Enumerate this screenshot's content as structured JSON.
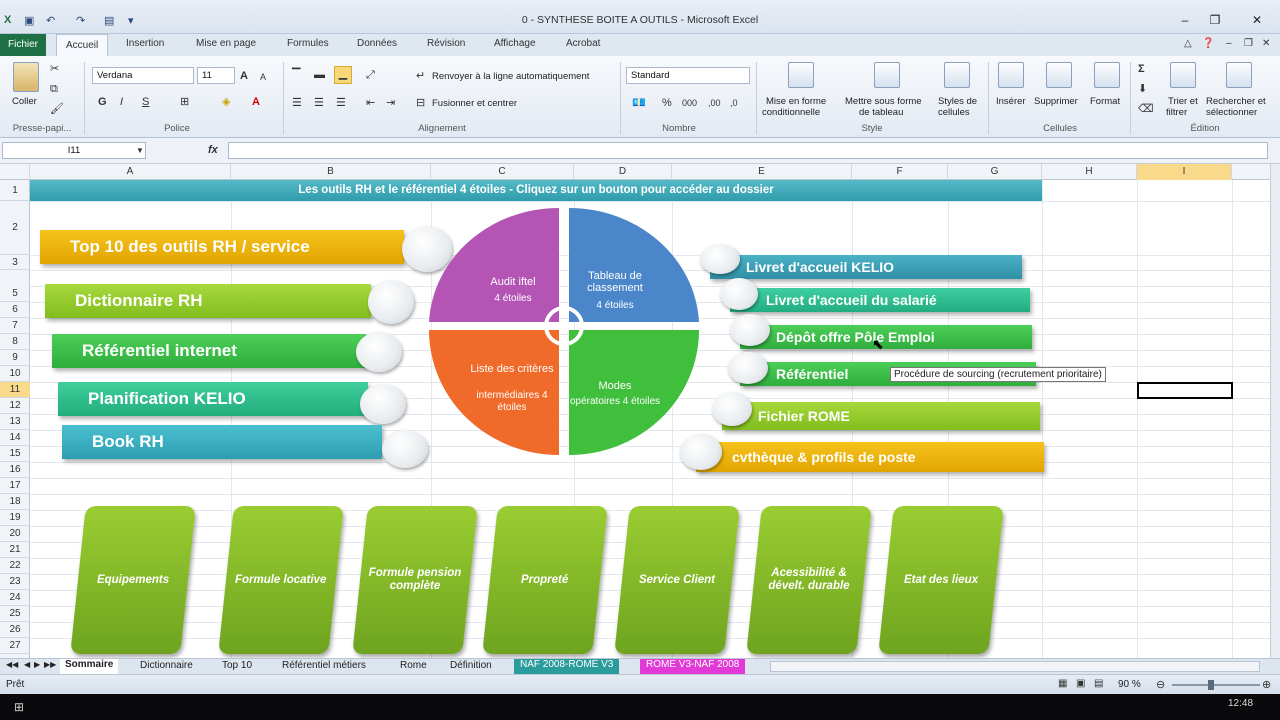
{
  "window": {
    "title": "0 - SYNTHESE BOITE A OUTILS - Microsoft Excel",
    "minimize": "–",
    "restore": "❐",
    "close": "✕"
  },
  "tabs": {
    "file": "Fichier",
    "items": [
      "Accueil",
      "Insertion",
      "Mise en page",
      "Formules",
      "Données",
      "Révision",
      "Affichage",
      "Acrobat"
    ]
  },
  "ribbon": {
    "clipboard": {
      "paste": "Coller",
      "group": "Presse-papi..."
    },
    "font": {
      "name": "Verdana",
      "size": "11",
      "group": "Police",
      "bold": "G",
      "italic": "I",
      "underline": "S"
    },
    "alignment": {
      "wrap": "Renvoyer à la ligne automatiquement",
      "merge": "Fusionner et centrer",
      "group": "Alignement"
    },
    "number": {
      "format": "Standard",
      "group": "Nombre"
    },
    "styles": {
      "cond1": "Mise en forme",
      "cond2": "conditionnelle",
      "table1": "Mettre sous forme",
      "table2": "de tableau",
      "cell1": "Styles de",
      "cell2": "cellules",
      "group": "Style"
    },
    "cells": {
      "insert": "Insérer",
      "delete": "Supprimer",
      "format": "Format",
      "group": "Cellules"
    },
    "editing": {
      "sort1": "Trier et",
      "sort2": "filtrer",
      "find1": "Rechercher et",
      "find2": "sélectionner",
      "group": "Édition"
    }
  },
  "formula_bar": {
    "name_box": "I11",
    "fx": "fx",
    "value": ""
  },
  "columns": [
    "A",
    "B",
    "C",
    "D",
    "E",
    "F",
    "G",
    "H",
    "I"
  ],
  "rows": [
    "1",
    "2",
    "3",
    "5",
    "6",
    "7",
    "8",
    "9",
    "10",
    "11",
    "12",
    "13",
    "14",
    "15",
    "16",
    "17",
    "18",
    "19",
    "20",
    "21",
    "22",
    "23",
    "24",
    "25",
    "26",
    "27"
  ],
  "banner": "Les outils RH et le référentiel 4 étoiles - Cliquez sur un bouton pour accéder au dossier",
  "left_buttons": [
    "Top 10 des outils RH / service",
    "Dictionnaire RH",
    "Référentiel internet",
    "Planification KELIO",
    "Book RH"
  ],
  "right_buttons": [
    "Livret d'accueil  KELIO",
    "Livret d'accueil  du salarié",
    "Dépôt offre Pôle Emploi",
    "Référentiel",
    "Fichier ROME",
    "cvthèque  & profils de poste"
  ],
  "tooltip": "Procédure de sourcing (recrutement prioritaire)",
  "pie": [
    {
      "label": "Audit iftel",
      "sub": "4 étoiles",
      "color": "#b455b6"
    },
    {
      "label": "Tableau de classement",
      "sub": "4 étoiles",
      "color": "#4a86c9"
    },
    {
      "label": "Liste des critères",
      "sub": "intermédiaires 4 étoiles",
      "color": "#f06a2a"
    },
    {
      "label": "Modes",
      "sub": "opératoires 4 étoiles",
      "color": "#3fbf3c"
    }
  ],
  "cards": [
    "Equipements",
    "Formule locative",
    "Formule pension complète",
    "Propreté",
    "Service Client",
    "Acessibilité & dévelt. durable",
    "Etat des lieux"
  ],
  "sheet_tabs": [
    "Sommaire",
    "Dictionnaire",
    "Top 10",
    "Référentiel métiers",
    "Rome",
    "Définition",
    "NAF 2008-ROME V3",
    "ROME V3-NAF 2008"
  ],
  "status": {
    "ready": "Prêt",
    "zoom": "90 %"
  },
  "clock": "12:48"
}
